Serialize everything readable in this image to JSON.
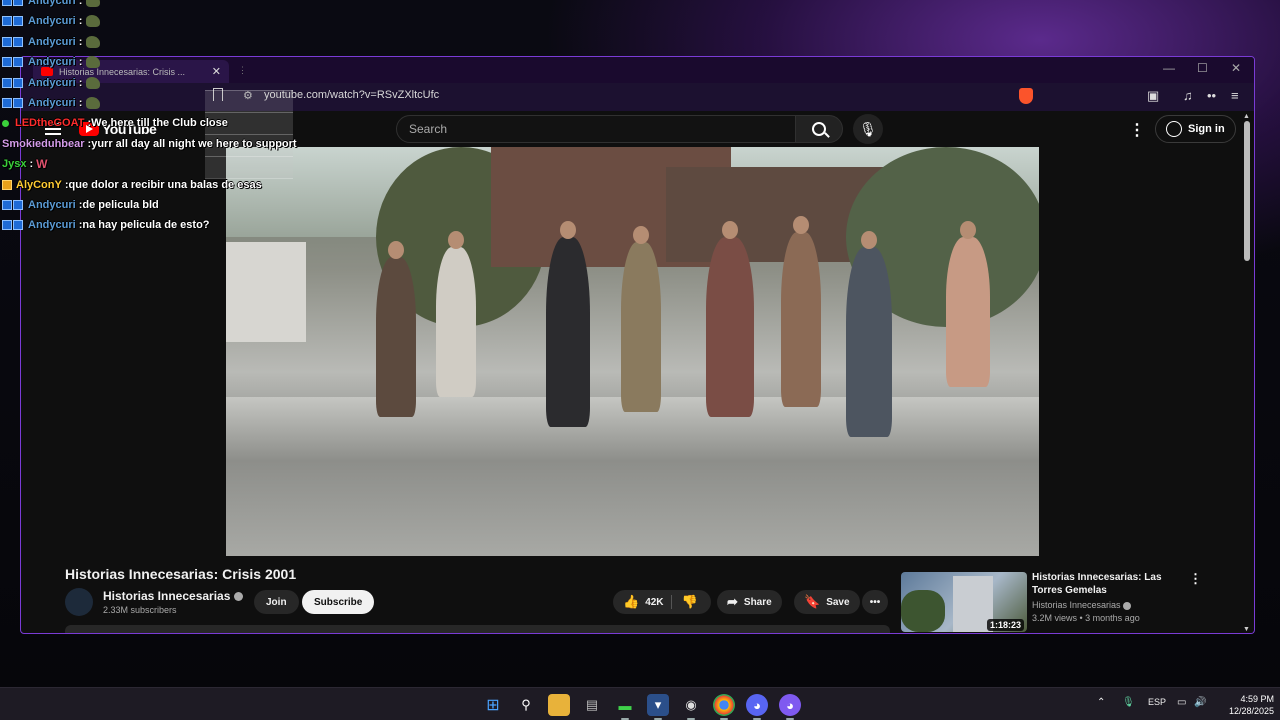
{
  "browser": {
    "tab_title": "Historias Innecesarias: Crisis ...",
    "url": "youtube.com/watch?v=RSvZXltcUfc"
  },
  "youtube": {
    "logo_text": "YouTube",
    "search_placeholder": "Search",
    "signin_label": "Sign in"
  },
  "video": {
    "title": "Historias Innecesarias: Crisis 2001",
    "channel": "Historias Innecesarias",
    "subscribers": "2.33M subscribers",
    "join_label": "Join",
    "subscribe_label": "Subscribe",
    "likes": "42K",
    "share_label": "Share",
    "save_label": "Save"
  },
  "suggested": {
    "title": "Historias Innecesarias: Las Torres Gemelas",
    "channel": "Historias Innecesarias",
    "meta": "3.2M views • 3 months ago",
    "duration": "1:18:23"
  },
  "chat": [
    {
      "user": "Andycuri",
      "color": "#5b9bd5",
      "badge": "prime",
      "msg": "",
      "emote": true
    },
    {
      "user": "Andycuri",
      "color": "#5b9bd5",
      "badge": "prime",
      "msg": "",
      "emote": true
    },
    {
      "user": "Andycuri",
      "color": "#5b9bd5",
      "badge": "prime",
      "msg": "",
      "emote": true
    },
    {
      "user": "Andycuri",
      "color": "#5b9bd5",
      "badge": "prime",
      "msg": "",
      "emote": true
    },
    {
      "user": "Andycuri",
      "color": "#5b9bd5",
      "badge": "prime",
      "msg": "",
      "emote": true
    },
    {
      "user": "Andycuri",
      "color": "#5b9bd5",
      "badge": "prime",
      "msg": "",
      "emote": true
    },
    {
      "user": "LEDtheGOAT",
      "color": "#ff2d2d",
      "badge": "green",
      "msg": "We here till the Club close",
      "emote": false
    },
    {
      "user": "Smokieduhbear",
      "color": "#d39be8",
      "badge": "",
      "msg": "yurr all day all night we here to support",
      "emote": false
    },
    {
      "user": "Jysx",
      "color": "#3bd13b",
      "badge": "",
      "msg": "",
      "emote": false,
      "w": "W"
    },
    {
      "user": "AlyConY",
      "color": "#ffcc33",
      "badge": "gold",
      "msg": "que dolor a recibir una balas de esas",
      "emote": false
    },
    {
      "user": "Andycuri",
      "color": "#5b9bd5",
      "badge": "prime",
      "msg": "de pelicula bld",
      "emote": false
    },
    {
      "user": "Andycuri",
      "color": "#5b9bd5",
      "badge": "prime",
      "msg": "na hay pelicula de esto?",
      "emote": false
    }
  ],
  "taskbar": {
    "lang": "ESP",
    "time": "4:59 PM",
    "date": "12/28/2025"
  },
  "colors": {
    "accent_purple": "#7a3bd6",
    "youtube_red": "#ff0000"
  }
}
